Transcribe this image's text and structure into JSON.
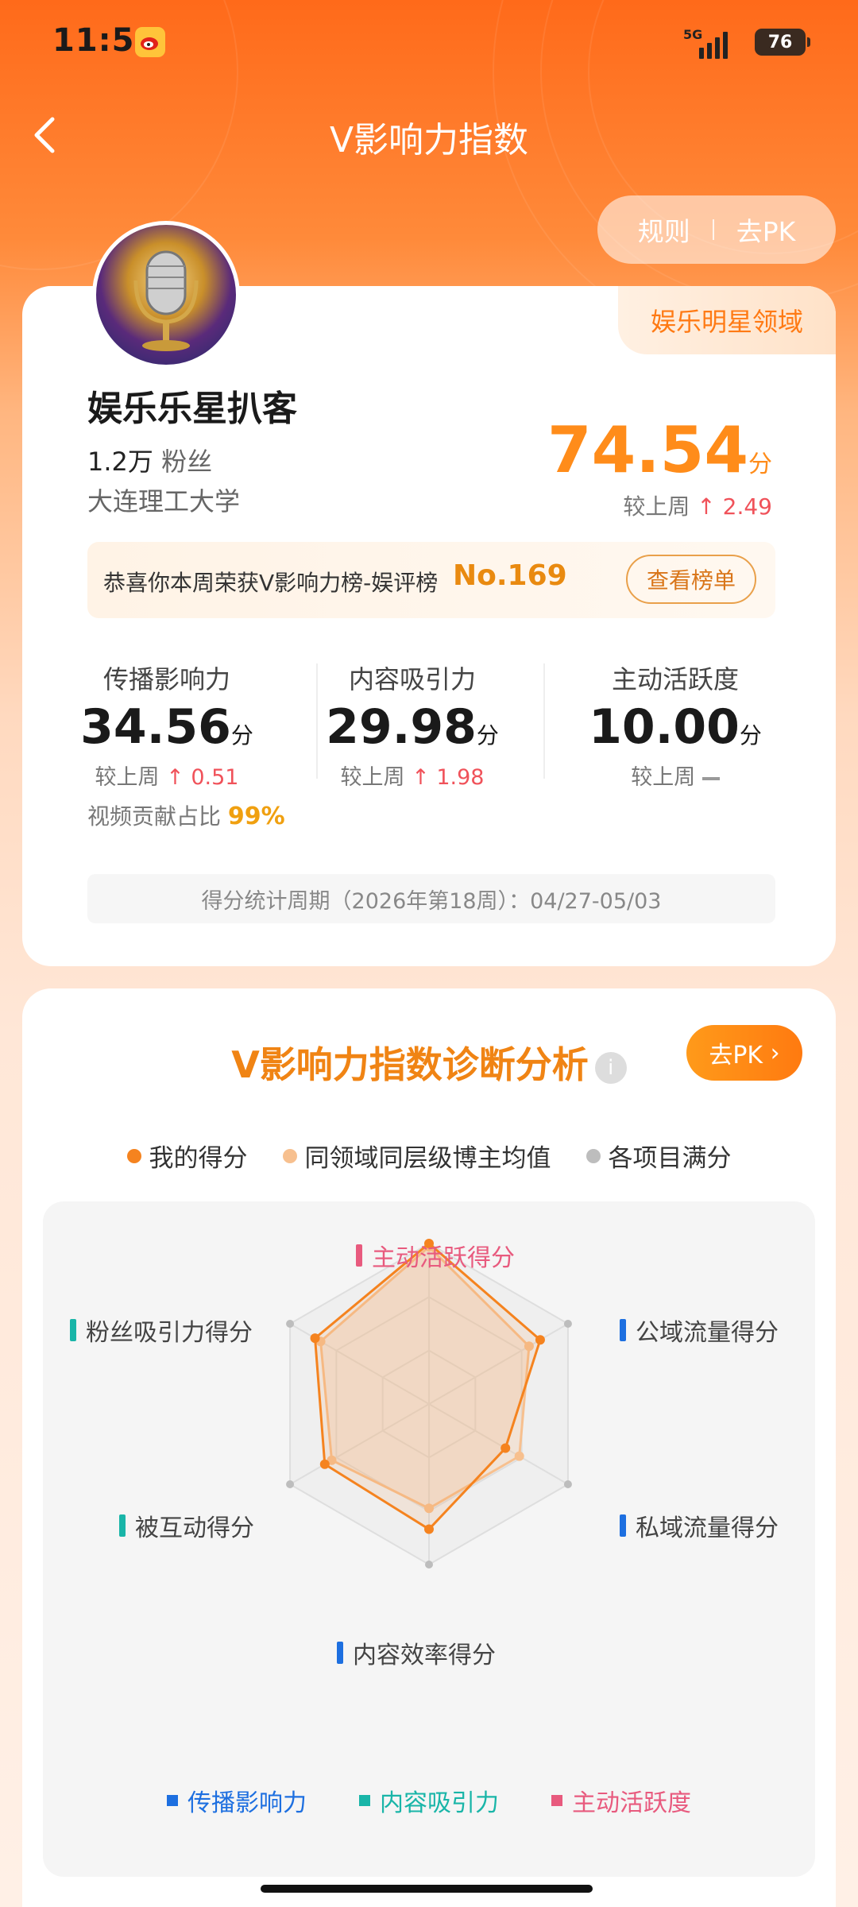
{
  "status_bar": {
    "time": "11:51",
    "network": "5G",
    "battery": "76"
  },
  "header": {
    "title": "V影响力指数",
    "rules": "规则",
    "pk": "去PK"
  },
  "profile": {
    "domain": "娱乐明星领域",
    "name": "娱乐乐星扒客",
    "fans_count": "1.2万",
    "fans_label": "粉丝",
    "school": "大连理工大学",
    "total_score": "74.54",
    "score_unit": "分",
    "vs_last_week_label": "较上周",
    "total_delta": "2.49"
  },
  "award": {
    "text": "恭喜你本周荣获V影响力榜-娱评榜",
    "rank": "No.169",
    "button": "查看榜单"
  },
  "metrics": [
    {
      "label": "传播影响力",
      "value": "34.56",
      "delta": "0.51"
    },
    {
      "label": "内容吸引力",
      "value": "29.98",
      "delta": "1.98"
    },
    {
      "label": "主动活跃度",
      "value": "10.00",
      "delta": ""
    }
  ],
  "video_share": {
    "label": "视频贡献占比",
    "value": "99%"
  },
  "period": "得分统计周期（2026年第18周）：04/27-05/03",
  "diagnosis": {
    "title": "V影响力指数诊断分析",
    "pk_button": "去PK",
    "legend": [
      {
        "label": "我的得分",
        "color": "#f5831f"
      },
      {
        "label": "同领域同层级博主均值",
        "color": "#f7c08f"
      },
      {
        "label": "各项目满分",
        "color": "#bdbdbd"
      }
    ],
    "axes": [
      {
        "label": "主动活跃得分",
        "color": "#e85a7e"
      },
      {
        "label": "公域流量得分",
        "color": "#1d6fe0"
      },
      {
        "label": "私域流量得分",
        "color": "#1d6fe0"
      },
      {
        "label": "内容效率得分",
        "color": "#1d6fe0"
      },
      {
        "label": "被互动得分",
        "color": "#19b5a8"
      },
      {
        "label": "粉丝吸引力得分",
        "color": "#19b5a8"
      }
    ],
    "my_scores": [
      1.0,
      0.8,
      0.55,
      0.78,
      0.75,
      0.82
    ],
    "avg_scores": [
      0.98,
      0.72,
      0.65,
      0.65,
      0.7,
      0.78
    ],
    "categories": [
      {
        "label": "传播影响力",
        "color": "#1d6fe0"
      },
      {
        "label": "内容吸引力",
        "color": "#19b5a8"
      },
      {
        "label": "主动活跃度",
        "color": "#e85a7e"
      }
    ]
  }
}
